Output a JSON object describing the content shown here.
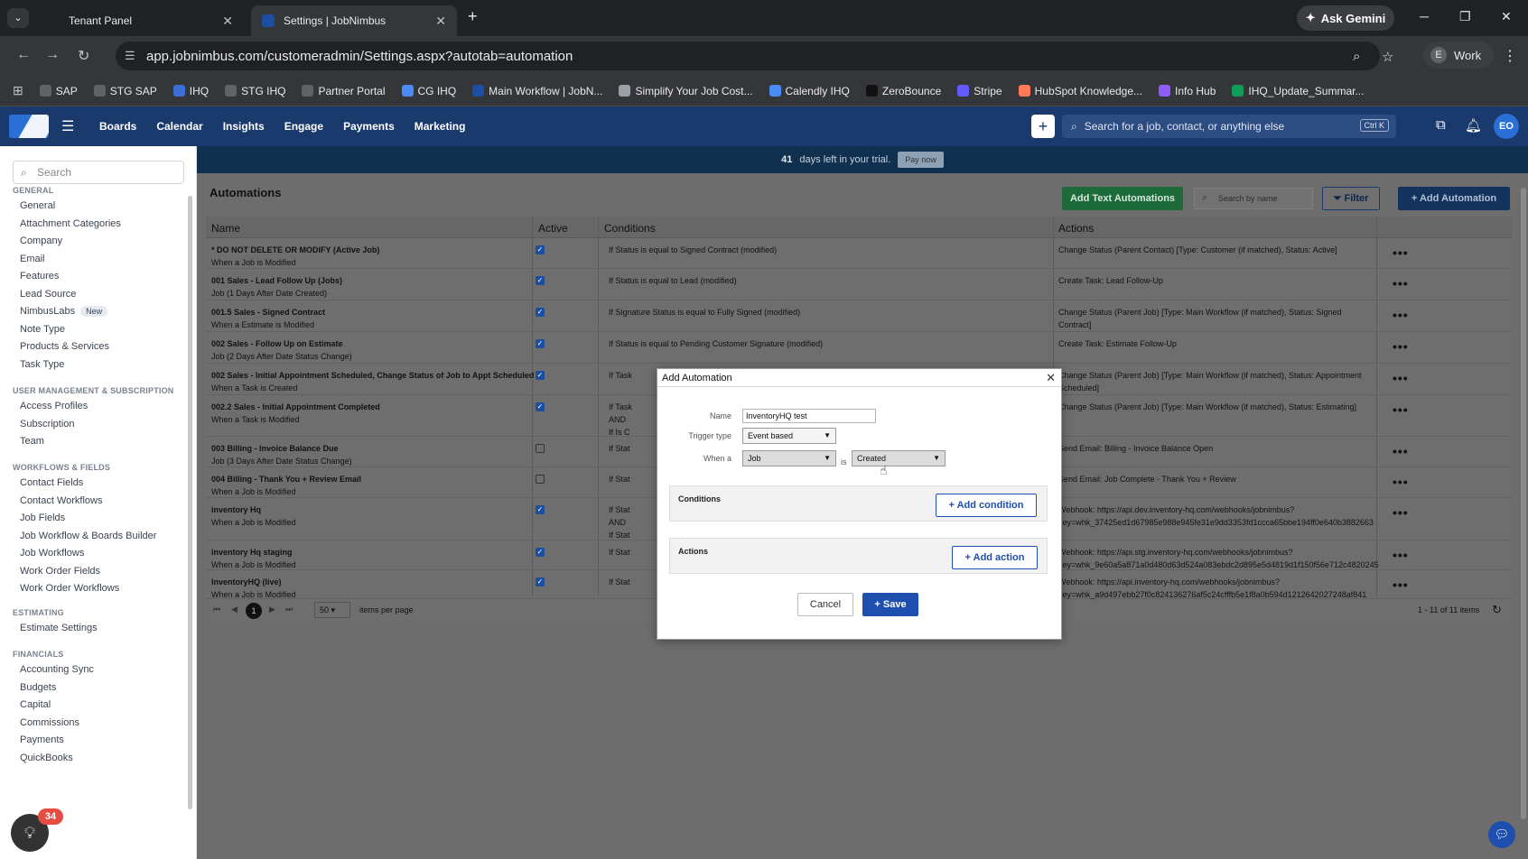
{
  "browser": {
    "tab_list_icon": "chevron-down-icon",
    "tabs": [
      {
        "title": "Tenant Panel",
        "active": false
      },
      {
        "title": "Settings | JobNimbus",
        "active": true
      }
    ],
    "new_tab": "+",
    "gemini_label": "Ask Gemini",
    "url": "app.jobnimbus.com/customeradmin/Settings.aspx?autotab=automation",
    "profile_initial": "E",
    "profile_label": "Work"
  },
  "bookmarks": [
    {
      "label": "SAP",
      "color": "#5f6368"
    },
    {
      "label": "STG SAP",
      "color": "#5f6368"
    },
    {
      "label": "IHQ",
      "color": "#3b6fd4"
    },
    {
      "label": "STG IHQ",
      "color": "#5f6368"
    },
    {
      "label": "Partner Portal",
      "color": "#5f6368"
    },
    {
      "label": "CG IHQ",
      "color": "#4a8af4"
    },
    {
      "label": "Main Workflow | JobN...",
      "color": "#1c4fa3"
    },
    {
      "label": "Simplify Your Job Cost...",
      "color": "#9aa0a6"
    },
    {
      "label": "Calendly IHQ",
      "color": "#4a8af4"
    },
    {
      "label": "ZeroBounce",
      "color": "#111111"
    },
    {
      "label": "Stripe",
      "color": "#635bff"
    },
    {
      "label": "HubSpot Knowledge...",
      "color": "#ff7a59"
    },
    {
      "label": "Info Hub",
      "color": "#8e5cf7"
    },
    {
      "label": "IHQ_Update_Summar...",
      "color": "#0f9d58"
    }
  ],
  "app_nav": [
    "Boards",
    "Calendar",
    "Insights",
    "Engage",
    "Payments",
    "Marketing"
  ],
  "global_search": {
    "placeholder": "Search for a job, contact, or anything else",
    "shortcut": "Ctrl K"
  },
  "user_initials": "EO",
  "sidebar": {
    "search_placeholder": "Search",
    "sections": [
      {
        "title": "GENERAL",
        "items": [
          "General",
          "Attachment Categories",
          "Company",
          "Email",
          "Features",
          "Lead Source",
          "NimbusLabs",
          "Note Type",
          "Products & Services",
          "Task Type"
        ]
      },
      {
        "title": "USER MANAGEMENT & SUBSCRIPTION",
        "items": [
          "Access Profiles",
          "Subscription",
          "Team"
        ]
      },
      {
        "title": "WORKFLOWS & FIELDS",
        "items": [
          "Contact Fields",
          "Contact Workflows",
          "Job Fields",
          "Job Workflow & Boards Builder",
          "Job Workflows",
          "Work Order Fields",
          "Work Order Workflows"
        ]
      },
      {
        "title": "ESTIMATING",
        "items": [
          "Estimate Settings"
        ]
      },
      {
        "title": "FINANCIALS",
        "items": [
          "Accounting Sync",
          "Budgets",
          "Capital",
          "Commissions",
          "Payments",
          "QuickBooks"
        ]
      }
    ],
    "new_badge": "New",
    "help_count": "34"
  },
  "trial": {
    "days": "41",
    "text": "days left in your trial.",
    "pay_label": "Pay now"
  },
  "automations": {
    "title": "Automations",
    "add_text_label": "Add Text Automations",
    "search_placeholder": "Search by name",
    "filter_label": "Filter",
    "add_label": "+ Add Automation",
    "columns": [
      "Name",
      "Active",
      "Conditions",
      "Actions"
    ],
    "rows": [
      {
        "name": "* DO NOT DELETE OR MODIFY (Active Job)",
        "sub": "When a Job is Modified",
        "active": true,
        "cond": "If Status is equal to Signed Contract (modified)",
        "action": "Change Status (Parent Contact) [Type: Customer (if matched), Status: Active]"
      },
      {
        "name": "001 Sales - Lead Follow Up (Jobs)",
        "sub": "Job (1 Days After Date Created)",
        "active": true,
        "cond": "If Status is equal to Lead (modified)",
        "action": "Create Task: Lead Follow-Up"
      },
      {
        "name": "001.5 Sales - Signed Contract",
        "sub": "When a Estimate is Modified",
        "active": true,
        "cond": "If Signature Status is equal to Fully Signed (modified)",
        "action": "Change Status (Parent Job) [Type: Main Workflow (if matched), Status: Signed Contract]"
      },
      {
        "name": "002 Sales - Follow Up on Estimate",
        "sub": "Job (2 Days After Date Status Change)",
        "active": true,
        "cond": "If Status is equal to Pending Customer Signature (modified)",
        "action": "Create Task: Estimate Follow-Up"
      },
      {
        "name": "002 Sales - Initial Appointment Scheduled, Change Status of Job to Appt Scheduled",
        "sub": "When a Task is Created",
        "active": true,
        "cond": "If Task",
        "action": "Change Status (Parent Job) [Type: Main Workflow (if matched), Status: Appointment Scheduled]"
      },
      {
        "name": "002.2 Sales - Initial Appointment Completed",
        "sub": "When a Task is Modified",
        "active": true,
        "cond": "If Task\nAND\nIf Is C",
        "action": "Change Status (Parent Job) [Type: Main Workflow (if matched), Status: Estimating]"
      },
      {
        "name": "003 Billing - Invoice Balance Due",
        "sub": "Job (3 Days After Date Status Change)",
        "active": false,
        "cond": "If Stat",
        "action": "Send Email: Billing - Invoice Balance Open"
      },
      {
        "name": "004 Billing - Thank You + Review Email",
        "sub": "When a Job is Modified",
        "active": false,
        "cond": "If Stat",
        "action": "Send Email: Job Complete - Thank You + Review"
      },
      {
        "name": "inventory Hq",
        "sub": "When a Job is Modified",
        "active": true,
        "cond": "If Stat\nAND\nIf Stat",
        "action": "Webhook: https://api.dev.inventory-hq.com/webhooks/jobnimbus?key=whk_37425ed1d67985e988e945fe31e9dd3353fd1ccca65bbe194ff0e640b3882663"
      },
      {
        "name": "inventory Hq staging",
        "sub": "When a Job is Modified",
        "active": true,
        "cond": "If Stat",
        "action": "Webhook: https://api.stg.inventory-hq.com/webhooks/jobnimbus?key=whk_9e60a5a871a0d480d63d524a083ebdc2d895e5d4819d1f150f56e712c4820245"
      },
      {
        "name": "InventoryHQ (live)",
        "sub": "When a Job is Modified",
        "active": true,
        "cond": "If Stat",
        "action": "Webhook: https://api.inventory-hq.com/webhooks/jobnimbus?key=whk_a9d497ebb27f0c824136276af5c24cfffb5e1f8a0b594d1212642027248af841"
      }
    ],
    "pager": {
      "current": "1",
      "page_size": "50",
      "per_page_label": "items per page",
      "count": "1 - 11 of 11 items"
    }
  },
  "modal": {
    "title": "Add Automation",
    "name_label": "Name",
    "name_value": "InventoryHQ test",
    "trigger_label": "Trigger type",
    "trigger_value": "Event based",
    "when_label": "When a",
    "when_value": "Job",
    "is_label": "is",
    "event_value": "Created",
    "conditions_label": "Conditions",
    "add_condition": "+ Add condition",
    "actions_label": "Actions",
    "add_action": "+ Add action",
    "cancel": "Cancel",
    "save": "+ Save"
  }
}
